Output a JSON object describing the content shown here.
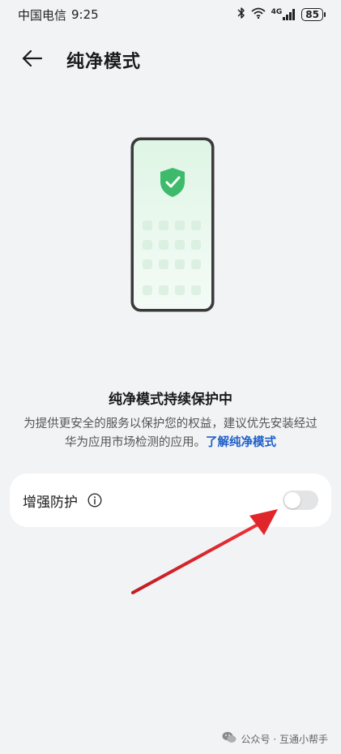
{
  "status_bar": {
    "carrier": "中国电信",
    "time": "9:25",
    "network": "4G",
    "battery": "85",
    "icons": [
      "bluetooth-icon",
      "wifi-icon",
      "signal-icon",
      "battery-icon"
    ]
  },
  "header": {
    "title": "纯净模式",
    "back_icon": "back-arrow-icon"
  },
  "illustration": {
    "icon": "shield-check-icon",
    "accent": "#3dbb6b"
  },
  "main": {
    "headline": "纯净模式持续保护中",
    "description": "为提供更安全的服务以保护您的权益，建议优先安装经过华为应用市场检测的应用。",
    "link_text": "了解纯净模式"
  },
  "setting": {
    "label": "增强防护",
    "info_icon": "info-icon",
    "toggle_on": false
  },
  "annotation": {
    "arrow_color": "#e0262b"
  },
  "watermark": {
    "text": "公众号 · 互通小帮手"
  }
}
